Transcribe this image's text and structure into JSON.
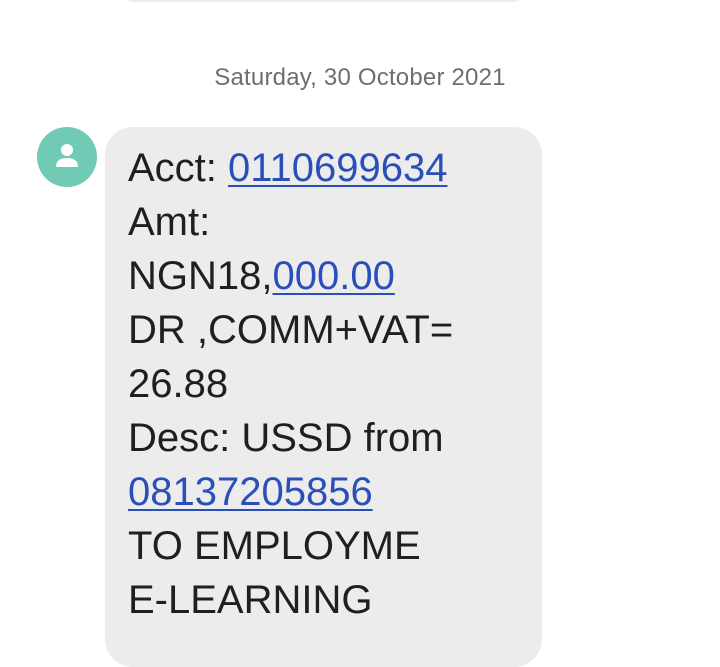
{
  "date_separator": "Saturday, 30 October 2021",
  "message": {
    "acct_prefix": "Acct: ",
    "acct_number": "0110699634",
    "amt_label": "Amt:",
    "amt_prefix": "NGN18,",
    "amt_link": "000.00",
    "dr_line": "DR ,COMM+VAT=",
    "fee": "26.88",
    "desc_line": "Desc: USSD from",
    "phone": "08137205856",
    "to_line": "TO EMPLOYME",
    "learning_line": "E-LEARNING"
  },
  "icons": {
    "avatar": "person-icon"
  },
  "colors": {
    "avatar_bg": "#71cbb4",
    "bubble_bg": "#ececec",
    "link": "#2b4fb8",
    "text": "#1f1f1f",
    "date_text": "#6e6e6e"
  }
}
